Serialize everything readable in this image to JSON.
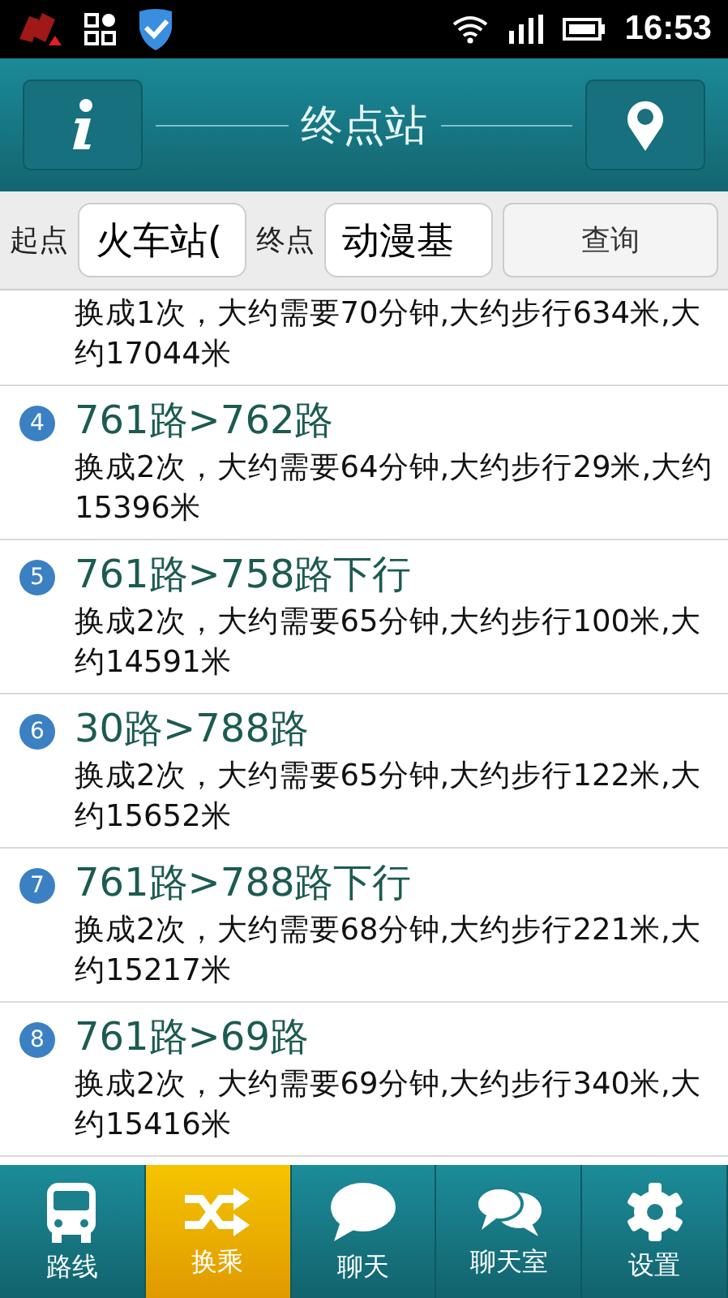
{
  "status_bar": {
    "time": "16:53"
  },
  "header": {
    "title": "终点站"
  },
  "search": {
    "from_label": "起点",
    "from_value": "火车站(",
    "to_label": "终点",
    "to_value": "动漫基",
    "button": "查询"
  },
  "routes": [
    {
      "description": "换成1次，大约需要70分钟,大约步行634米,大约17044米"
    },
    {
      "number": "4",
      "title": "761路>762路",
      "description": "换成2次，大约需要64分钟,大约步行29米,大约15396米"
    },
    {
      "number": "5",
      "title": "761路>758路下行",
      "description": "换成2次，大约需要65分钟,大约步行100米,大约14591米"
    },
    {
      "number": "6",
      "title": "30路>788路",
      "description": "换成2次，大约需要65分钟,大约步行122米,大约15652米"
    },
    {
      "number": "7",
      "title": "761路>788路下行",
      "description": "换成2次，大约需要68分钟,大约步行221米,大约15217米"
    },
    {
      "number": "8",
      "title": "761路>69路",
      "description": "换成2次，大约需要69分钟,大约步行340米,大约15416米"
    }
  ],
  "tabs": [
    {
      "label": "路线",
      "kind": "bus",
      "selected": false
    },
    {
      "label": "换乘",
      "kind": "shuffle",
      "selected": true
    },
    {
      "label": "聊天",
      "kind": "chat",
      "selected": false
    },
    {
      "label": "聊天室",
      "kind": "chats",
      "selected": false
    },
    {
      "label": "设置",
      "kind": "gear",
      "selected": false
    }
  ]
}
